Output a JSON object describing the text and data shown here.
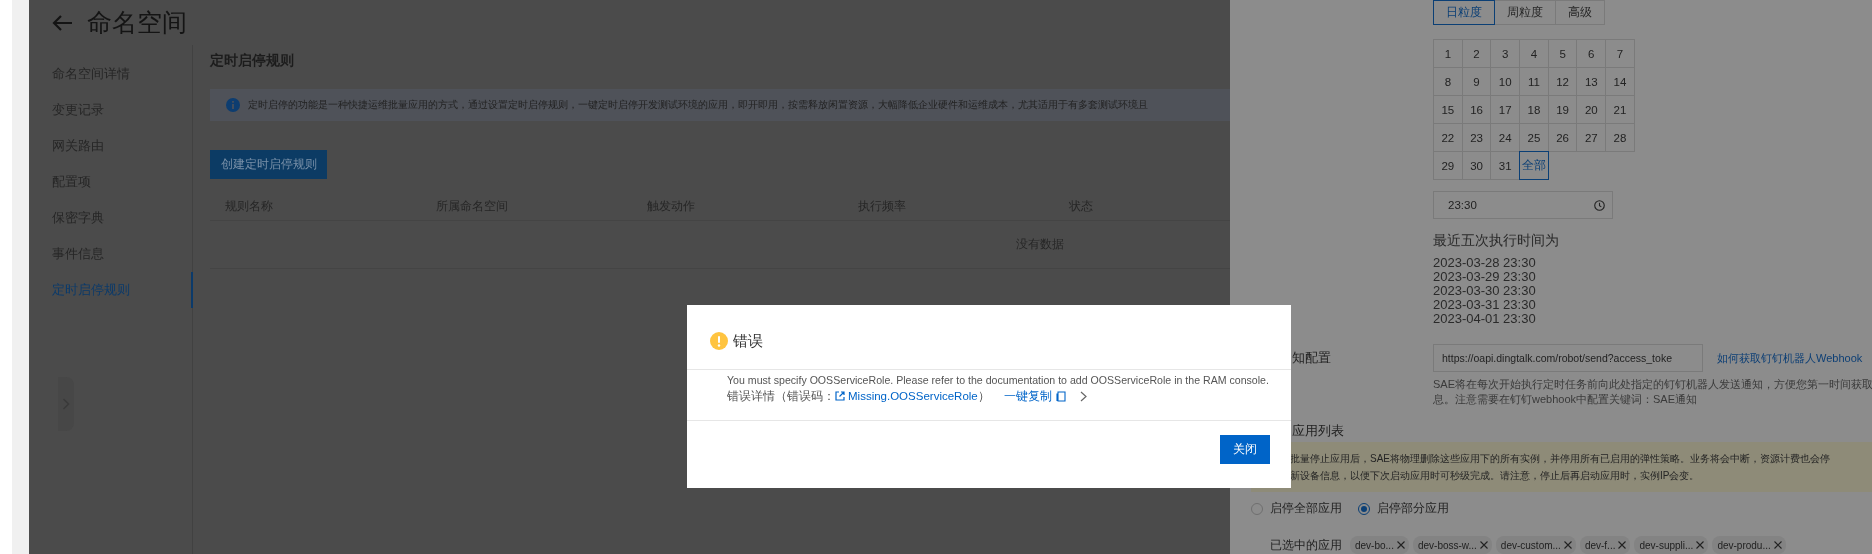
{
  "page": {
    "title": "命名空间"
  },
  "sidebar": {
    "items": [
      {
        "label": "命名空间详情",
        "selected": false
      },
      {
        "label": "变更记录",
        "selected": false
      },
      {
        "label": "网关路由",
        "selected": false
      },
      {
        "label": "配置项",
        "selected": false
      },
      {
        "label": "保密字典",
        "selected": false
      },
      {
        "label": "事件信息",
        "selected": false
      },
      {
        "label": "定时启停规则",
        "selected": true
      }
    ]
  },
  "content": {
    "heading": "定时启停规则",
    "info": "定时启停的功能是一种快捷运维批量应用的方式，通过设置定时启停规则，一键定时启停开发测试环境的应用，即开即用，按需释放闲置资源，大幅降低企业硬件和运维成本，尤其适用于有多套测试环境且",
    "create_button": "创建定时启停规则",
    "table": {
      "columns": [
        "规则名称",
        "所属命名空间",
        "触发动作",
        "执行频率",
        "状态"
      ],
      "empty_text": "没有数据"
    }
  },
  "drawer": {
    "granularity_tabs": [
      {
        "label": "日粒度",
        "selected": true
      },
      {
        "label": "周粒度",
        "selected": false
      },
      {
        "label": "高级",
        "selected": false
      }
    ],
    "day_cells": [
      {
        "label": "1",
        "selected": false
      },
      {
        "label": "2",
        "selected": false
      },
      {
        "label": "3",
        "selected": false
      },
      {
        "label": "4",
        "selected": false
      },
      {
        "label": "5",
        "selected": false
      },
      {
        "label": "6",
        "selected": false
      },
      {
        "label": "7",
        "selected": false
      },
      {
        "label": "8",
        "selected": false
      },
      {
        "label": "9",
        "selected": false
      },
      {
        "label": "10",
        "selected": false
      },
      {
        "label": "11",
        "selected": false
      },
      {
        "label": "12",
        "selected": false
      },
      {
        "label": "13",
        "selected": false
      },
      {
        "label": "14",
        "selected": false
      },
      {
        "label": "15",
        "selected": false
      },
      {
        "label": "16",
        "selected": false
      },
      {
        "label": "17",
        "selected": false
      },
      {
        "label": "18",
        "selected": false
      },
      {
        "label": "19",
        "selected": false
      },
      {
        "label": "20",
        "selected": false
      },
      {
        "label": "21",
        "selected": false
      },
      {
        "label": "22",
        "selected": false
      },
      {
        "label": "23",
        "selected": false
      },
      {
        "label": "24",
        "selected": false
      },
      {
        "label": "25",
        "selected": false
      },
      {
        "label": "26",
        "selected": false
      },
      {
        "label": "27",
        "selected": false
      },
      {
        "label": "28",
        "selected": false
      },
      {
        "label": "29",
        "selected": false
      },
      {
        "label": "30",
        "selected": false
      },
      {
        "label": "31",
        "selected": false
      },
      {
        "label": "全部",
        "selected": true
      }
    ],
    "time_field": {
      "value": "23:30"
    },
    "next_runs": {
      "title": "最近五次执行时间为",
      "times": [
        "2023-03-28 23:30",
        "2023-03-29 23:30",
        "2023-03-30 23:30",
        "2023-03-31 23:30",
        "2023-04-01 23:30"
      ]
    },
    "notification": {
      "label": "知配置",
      "webhook_field": {
        "value": "https://oapi.dingtalk.com/robot/send?access_toke"
      },
      "help_link": "如何获取钉钉机器人Webhook",
      "help_text": [
        "SAE将在每次开始执行定时任务前向此处指定的钉钉机器人发送通知，方便您第一时间获取",
        "息。注意需要在钉钉webhook中配置关键词：SAE通知"
      ]
    },
    "app_list": {
      "label": "应用列表",
      "warning": [
        "批量停止应用后，SAE将物理删除这些应用下的所有实例，并停用所有已启用的弹性策略。业务将会中断，资源计费也会停",
        "新设备信息，以便下次启动应用时可秒级完成。请注意，停止后再启动应用时，实例IP会变。"
      ],
      "scope_options": [
        {
          "label": "启停全部应用",
          "selected": false
        },
        {
          "label": "启停部分应用",
          "selected": true
        }
      ],
      "selected_label": "已选中的应用",
      "tags": [
        "dev-bo...",
        "dev-boss-w...",
        "dev-custom...",
        "dev-f...",
        "dev-suppli...",
        "dev-produ..."
      ]
    }
  },
  "dialog": {
    "title": "错误",
    "message": "You must specify OOSServiceRole. Please refer to the documentation to add OOSServiceRole in the RAM console.",
    "detail_prefix": "错误详情（错误码：",
    "error_code": "Missing.OOSServiceRole",
    "detail_suffix": "）",
    "copy_link": "一键复制",
    "close_button": "关闭"
  }
}
